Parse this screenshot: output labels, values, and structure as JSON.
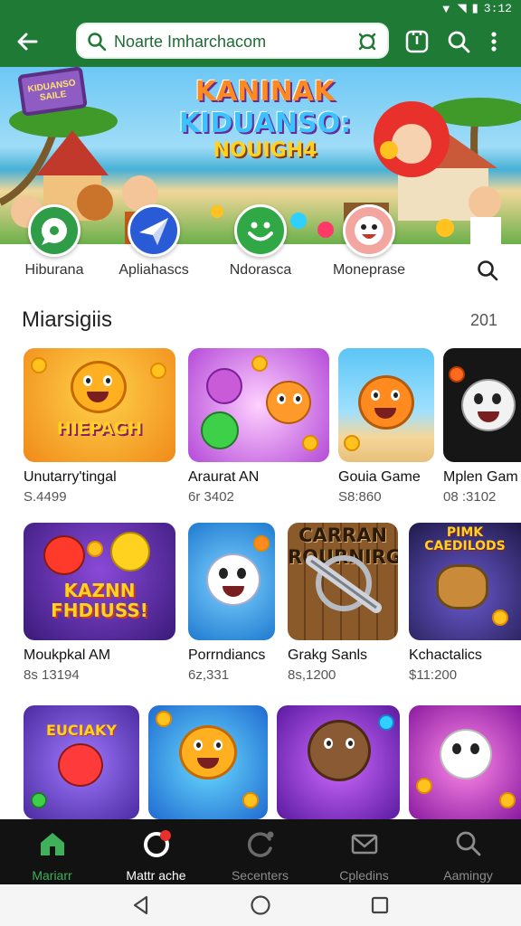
{
  "status_bar": {
    "time": "3:12"
  },
  "search": {
    "query": "Noarte Imharchacom"
  },
  "banner": {
    "title_lines": [
      "KANINAK",
      "KIDUANSO:",
      "NOUIGH4"
    ],
    "sign_text": "KIDUANSO SAILE"
  },
  "categories": [
    {
      "label": "Hiburana",
      "color": "#2f9c47",
      "icon": "chat-bubble-icon"
    },
    {
      "label": "Apliahascs",
      "color": "#2a5bd7",
      "icon": "send-arrow-icon"
    },
    {
      "label": "Ndorasca",
      "color": "#2fa845",
      "icon": "smiley-icon"
    },
    {
      "label": "Moneprase",
      "color": "#f3a6a0",
      "icon": "cartoon-face-icon"
    }
  ],
  "section": {
    "title": "Miarsigiis",
    "count": "201"
  },
  "apps": [
    {
      "name": "Unutarry'tingal",
      "size": "S.4499",
      "art_text": "HIEPAGH",
      "bg": "#f4a21f",
      "face": "#ffb020"
    },
    {
      "name": "Araurat AN",
      "size": "6r 3402",
      "art_text": "",
      "bg": "#c955e0",
      "face": "#ff9a2a"
    },
    {
      "name": "Gouia Game",
      "size": "S8:860",
      "art_text": "",
      "bg": "#3fa9e8",
      "face": "#ff8a1f"
    },
    {
      "name": "Mplen Gam",
      "size": "08 :3102",
      "art_text": "",
      "bg": "#1b1b1b",
      "face": "#f2f2f2"
    },
    {
      "name": "Moukpkal AM",
      "size": "8s 13194",
      "art_text": "KAZNN FHDIUSS!",
      "bg": "#5a2a9e",
      "face": "#ff3a2a"
    },
    {
      "name": "Porrndiancs",
      "size": "6z,331",
      "art_text": "",
      "bg": "#2f8fe8",
      "face": "#ffffff"
    },
    {
      "name": "Grakg Sanls",
      "size": "8s,1200",
      "art_text": "CARRAN ROURNIRGY",
      "bg": "#7a4a25",
      "face": "#9aa0a8"
    },
    {
      "name": "Kchactalics",
      "size": "$11:200",
      "art_text": "PIMK CAEDILODS",
      "bg": "#3a2a7a",
      "face": "#c98a3a"
    },
    {
      "name": "",
      "size": "",
      "art_text": "EUCIAKY",
      "bg": "#6a3fd0",
      "face": "#ff3a3a"
    },
    {
      "name": "",
      "size": "",
      "art_text": "",
      "bg": "#1f9ad8",
      "face": "#ffb020"
    },
    {
      "name": "",
      "size": "",
      "art_text": "",
      "bg": "#8a2fd0",
      "face": "#8a5a35"
    },
    {
      "name": "",
      "size": "",
      "art_text": "",
      "bg": "#c83ad0",
      "face": "#ffffff"
    }
  ],
  "bottom_nav": [
    {
      "label": "Mariarr",
      "icon": "home-icon"
    },
    {
      "label": "Mattr ache",
      "icon": "games-icon"
    },
    {
      "label": "Secenters",
      "icon": "refresh-icon"
    },
    {
      "label": "Cpledins",
      "icon": "mail-icon"
    },
    {
      "label": "Aamingy",
      "icon": "search-icon"
    }
  ],
  "colors": {
    "appbar": "#1f7a36",
    "accent": "#3fb15a",
    "nav_bg": "#121212"
  }
}
